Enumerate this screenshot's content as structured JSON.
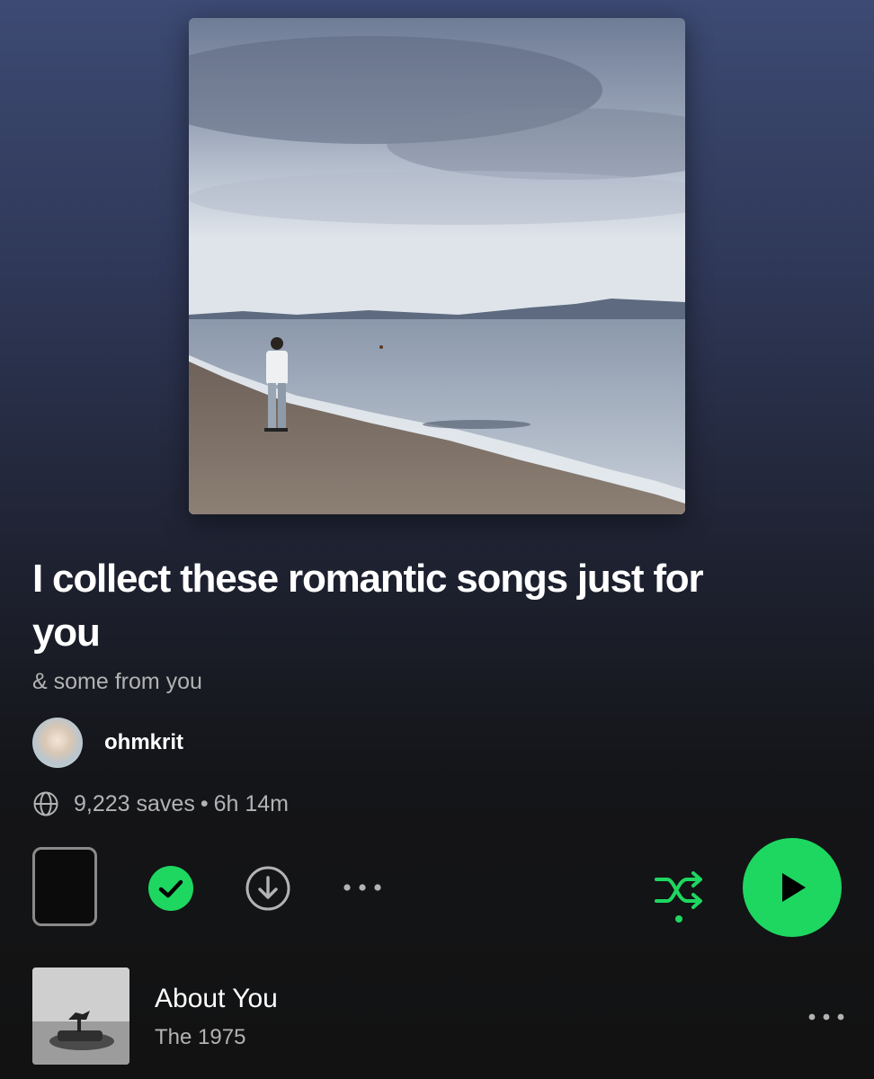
{
  "playlist": {
    "title": "I collect these romantic songs just for you",
    "description": "& some from you",
    "owner": "ohmkrit",
    "saves": "9,223 saves",
    "separator": "•",
    "duration": "6h 14m",
    "cover_icon": "playlist-cover-beach-photo"
  },
  "actions": {
    "saved_icon": "check-circle-icon",
    "download_icon": "download-circle-icon",
    "more_icon": "more-dots-icon",
    "shuffle_icon": "shuffle-icon",
    "play_icon": "play-icon"
  },
  "colors": {
    "accent": "#1ed760",
    "header_gradient_top": "#3d4a73",
    "background": "#121212",
    "secondary_text": "#b3b3b3"
  },
  "tracks": [
    {
      "title": "About You",
      "artist": "The 1975"
    }
  ]
}
